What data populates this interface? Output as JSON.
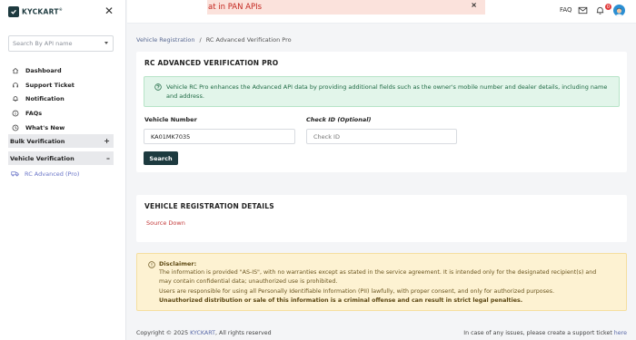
{
  "brand": {
    "logo_text": "KYCKART",
    "trademark": "®"
  },
  "sidebar": {
    "search_placeholder": "Search By API name",
    "nav_items": [
      {
        "label": "Dashboard",
        "icon": "home-icon"
      },
      {
        "label": "Support Ticket",
        "icon": "headset-icon"
      },
      {
        "label": "Notification",
        "icon": "bell-icon"
      },
      {
        "label": "FAQs",
        "icon": "info-icon"
      },
      {
        "label": "What's New",
        "icon": "clock-icon"
      }
    ],
    "groups": [
      {
        "label": "Bulk Verification",
        "toggle": "+"
      },
      {
        "label": "Vehicle Verification",
        "toggle": "–"
      }
    ],
    "sub_item": {
      "label": "RC Advanced (Pro)",
      "icon": "truck-icon"
    }
  },
  "topbar": {
    "toast_text": "at in PAN APIs",
    "toast_close": "×",
    "faq_label": "FAQ",
    "notification_count": "0"
  },
  "breadcrumb": {
    "parent": "Vehicle Registration",
    "separator": "/",
    "current": "RC Advanced Verification Pro"
  },
  "form_card": {
    "title": "RC ADVANCED VERIFICATION PRO",
    "info_text": "Vehicle RC Pro enhances the Advanced API data by providing additional fields such as the owner's mobile number and dealer details, including name and address.",
    "vehicle_number_label": "Vehicle Number",
    "vehicle_number_value": "KA01MK7035",
    "check_id_label": "Check ID (Optional)",
    "check_id_placeholder": "Check ID",
    "search_button": "Search"
  },
  "details_card": {
    "title": "VEHICLE REGISTRATION DETAILS",
    "status_text": "Source Down"
  },
  "disclaimer": {
    "title": "Disclaimer:",
    "lines": [
      "The information is provided \"AS-IS\", with no warranties except as stated in the service agreement. It is intended only for the designated recipient(s) and",
      "may contain confidential data; unauthorized use is prohibited.",
      "Users are responsible for using all Personally Identifiable Information (PII) lawfully, with proper consent, and only for authorized purposes."
    ],
    "bold_line": "Unauthorized distribution or sale of this information is a criminal offense and can result in strict legal penalties."
  },
  "footer": {
    "copyright_prefix": "Copyright © 2025 ",
    "brand": "KYCKART",
    "copyright_suffix": ", All rights reserved",
    "support_prefix": "In case of any issues, please create a support ticket ",
    "support_link": "here"
  },
  "colors": {
    "primary": "#1d3a3f",
    "info_bg": "#e2f5ea",
    "info_text": "#1f6a44",
    "error_text": "#c33a3a",
    "warning_bg": "#fdf2d2",
    "link": "#5a6aa8",
    "toast_bg": "#fbe2dc",
    "toast_text": "#c3261f"
  }
}
